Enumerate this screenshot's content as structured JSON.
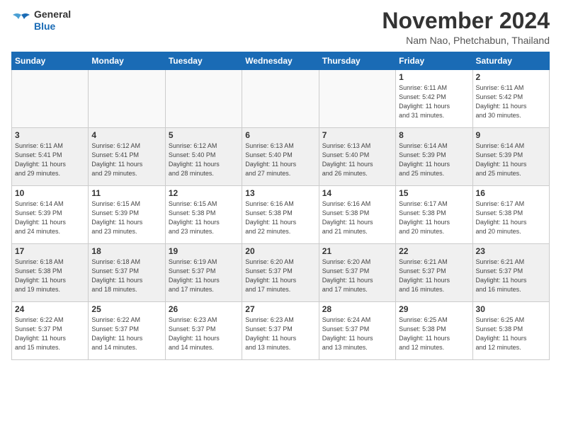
{
  "logo": {
    "general": "General",
    "blue": "Blue"
  },
  "header": {
    "month": "November 2024",
    "location": "Nam Nao, Phetchabun, Thailand"
  },
  "weekdays": [
    "Sunday",
    "Monday",
    "Tuesday",
    "Wednesday",
    "Thursday",
    "Friday",
    "Saturday"
  ],
  "weeks": [
    [
      {
        "day": "",
        "info": ""
      },
      {
        "day": "",
        "info": ""
      },
      {
        "day": "",
        "info": ""
      },
      {
        "day": "",
        "info": ""
      },
      {
        "day": "",
        "info": ""
      },
      {
        "day": "1",
        "info": "Sunrise: 6:11 AM\nSunset: 5:42 PM\nDaylight: 11 hours\nand 31 minutes."
      },
      {
        "day": "2",
        "info": "Sunrise: 6:11 AM\nSunset: 5:42 PM\nDaylight: 11 hours\nand 30 minutes."
      }
    ],
    [
      {
        "day": "3",
        "info": "Sunrise: 6:11 AM\nSunset: 5:41 PM\nDaylight: 11 hours\nand 29 minutes."
      },
      {
        "day": "4",
        "info": "Sunrise: 6:12 AM\nSunset: 5:41 PM\nDaylight: 11 hours\nand 29 minutes."
      },
      {
        "day": "5",
        "info": "Sunrise: 6:12 AM\nSunset: 5:40 PM\nDaylight: 11 hours\nand 28 minutes."
      },
      {
        "day": "6",
        "info": "Sunrise: 6:13 AM\nSunset: 5:40 PM\nDaylight: 11 hours\nand 27 minutes."
      },
      {
        "day": "7",
        "info": "Sunrise: 6:13 AM\nSunset: 5:40 PM\nDaylight: 11 hours\nand 26 minutes."
      },
      {
        "day": "8",
        "info": "Sunrise: 6:14 AM\nSunset: 5:39 PM\nDaylight: 11 hours\nand 25 minutes."
      },
      {
        "day": "9",
        "info": "Sunrise: 6:14 AM\nSunset: 5:39 PM\nDaylight: 11 hours\nand 25 minutes."
      }
    ],
    [
      {
        "day": "10",
        "info": "Sunrise: 6:14 AM\nSunset: 5:39 PM\nDaylight: 11 hours\nand 24 minutes."
      },
      {
        "day": "11",
        "info": "Sunrise: 6:15 AM\nSunset: 5:39 PM\nDaylight: 11 hours\nand 23 minutes."
      },
      {
        "day": "12",
        "info": "Sunrise: 6:15 AM\nSunset: 5:38 PM\nDaylight: 11 hours\nand 23 minutes."
      },
      {
        "day": "13",
        "info": "Sunrise: 6:16 AM\nSunset: 5:38 PM\nDaylight: 11 hours\nand 22 minutes."
      },
      {
        "day": "14",
        "info": "Sunrise: 6:16 AM\nSunset: 5:38 PM\nDaylight: 11 hours\nand 21 minutes."
      },
      {
        "day": "15",
        "info": "Sunrise: 6:17 AM\nSunset: 5:38 PM\nDaylight: 11 hours\nand 20 minutes."
      },
      {
        "day": "16",
        "info": "Sunrise: 6:17 AM\nSunset: 5:38 PM\nDaylight: 11 hours\nand 20 minutes."
      }
    ],
    [
      {
        "day": "17",
        "info": "Sunrise: 6:18 AM\nSunset: 5:38 PM\nDaylight: 11 hours\nand 19 minutes."
      },
      {
        "day": "18",
        "info": "Sunrise: 6:18 AM\nSunset: 5:37 PM\nDaylight: 11 hours\nand 18 minutes."
      },
      {
        "day": "19",
        "info": "Sunrise: 6:19 AM\nSunset: 5:37 PM\nDaylight: 11 hours\nand 17 minutes."
      },
      {
        "day": "20",
        "info": "Sunrise: 6:20 AM\nSunset: 5:37 PM\nDaylight: 11 hours\nand 17 minutes."
      },
      {
        "day": "21",
        "info": "Sunrise: 6:20 AM\nSunset: 5:37 PM\nDaylight: 11 hours\nand 17 minutes."
      },
      {
        "day": "22",
        "info": "Sunrise: 6:21 AM\nSunset: 5:37 PM\nDaylight: 11 hours\nand 16 minutes."
      },
      {
        "day": "23",
        "info": "Sunrise: 6:21 AM\nSunset: 5:37 PM\nDaylight: 11 hours\nand 16 minutes."
      }
    ],
    [
      {
        "day": "24",
        "info": "Sunrise: 6:22 AM\nSunset: 5:37 PM\nDaylight: 11 hours\nand 15 minutes."
      },
      {
        "day": "25",
        "info": "Sunrise: 6:22 AM\nSunset: 5:37 PM\nDaylight: 11 hours\nand 14 minutes."
      },
      {
        "day": "26",
        "info": "Sunrise: 6:23 AM\nSunset: 5:37 PM\nDaylight: 11 hours\nand 14 minutes."
      },
      {
        "day": "27",
        "info": "Sunrise: 6:23 AM\nSunset: 5:37 PM\nDaylight: 11 hours\nand 13 minutes."
      },
      {
        "day": "28",
        "info": "Sunrise: 6:24 AM\nSunset: 5:37 PM\nDaylight: 11 hours\nand 13 minutes."
      },
      {
        "day": "29",
        "info": "Sunrise: 6:25 AM\nSunset: 5:38 PM\nDaylight: 11 hours\nand 12 minutes."
      },
      {
        "day": "30",
        "info": "Sunrise: 6:25 AM\nSunset: 5:38 PM\nDaylight: 11 hours\nand 12 minutes."
      }
    ]
  ]
}
